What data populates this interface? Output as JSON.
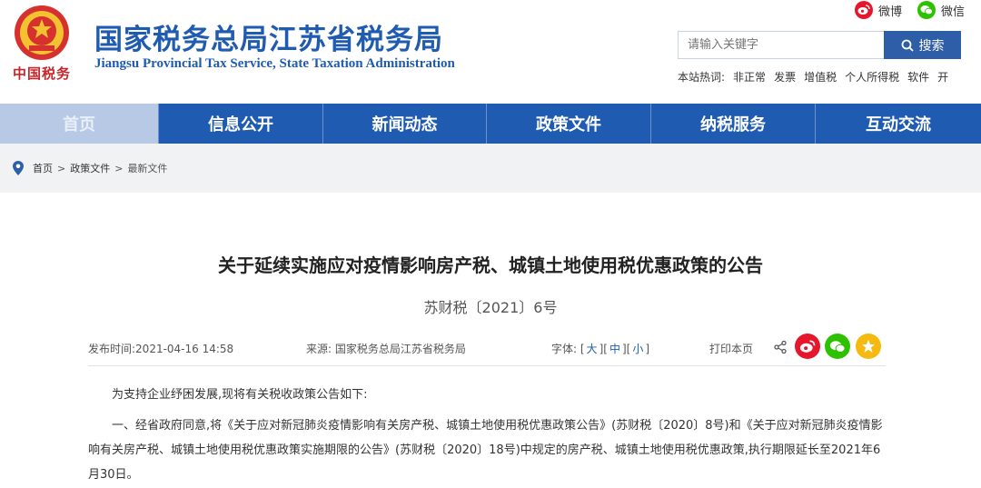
{
  "header": {
    "emblem_caption": "中国税务",
    "title": "国家税务总局江苏省税务局",
    "subtitle": "Jiangsu Provincial Tax Service, State Taxation Administration",
    "social": {
      "weibo": "微博",
      "wechat": "微信"
    },
    "search": {
      "placeholder": "请输入关键字",
      "button": "搜索"
    },
    "hot": {
      "label": "本站热词:",
      "keywords": [
        "非正常",
        "发票",
        "增值税",
        "个人所得税",
        "软件",
        "开"
      ]
    }
  },
  "nav": {
    "items": [
      "首页",
      "信息公开",
      "新闻动态",
      "政策文件",
      "纳税服务",
      "互动交流"
    ]
  },
  "breadcrumb": {
    "items": [
      "首页",
      "政策文件",
      "最新文件"
    ]
  },
  "article": {
    "title": "关于延续实施应对疫情影响房产税、城镇土地使用税优惠政策的公告",
    "doc_no": "苏财税〔2021〕6号",
    "meta": {
      "time": "发布时间:2021-04-16 14:58",
      "source": "来源:   国家税务总局江苏省税务局",
      "font_label": "字体:",
      "font_sizes": [
        "大",
        "中",
        "小"
      ],
      "print": "打印本页"
    },
    "paragraphs": [
      "为支持企业纾困发展,现将有关税收政策公告如下:",
      "一、经省政府同意,将《关于应对新冠肺炎疫情影响有关房产税、城镇土地使用税优惠政策公告》(苏财税〔2020〕8号)和《关于应对新冠肺炎疫情影响有关房产税、城镇土地使用税优惠政策实施期限的公告》(苏财税〔2020〕18号)中规定的房产税、城镇土地使用税优惠政策,执行期限延长至2021年6月30日。"
    ]
  },
  "colors": {
    "brand_blue": "#1f5bb0",
    "nav_home": "#b7c9e4",
    "weibo_red": "#e6162d",
    "wechat_green": "#2dc100",
    "fav_yellow": "#f5b90f"
  }
}
